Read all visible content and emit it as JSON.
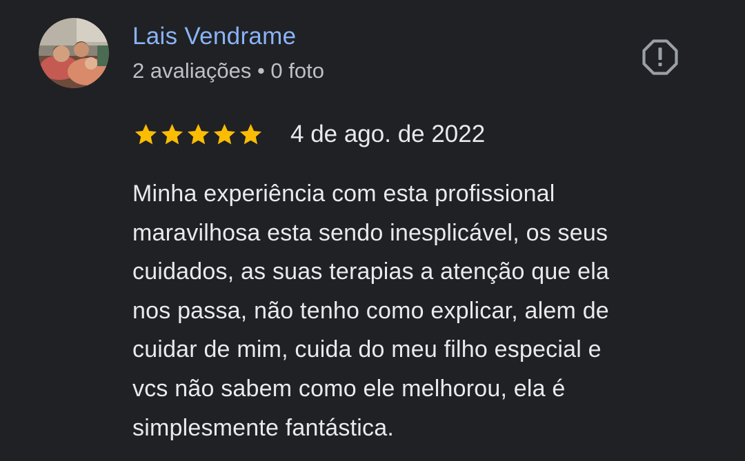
{
  "reviewer": {
    "name": "Lais Vendrame",
    "meta": "2 avaliações • 0 foto",
    "avatar_icon": "user-photo"
  },
  "rating": {
    "stars": 5,
    "max": 5,
    "color": "#fbbc04",
    "icon": "star-icon"
  },
  "review": {
    "date": "4 de ago. de 2022",
    "lines": [
      "Minha experiência com esta profissional",
      "maravilhosa esta sendo inesplicável, os seus",
      "cuidados, as suas terapias a atenção que ela",
      "nos passa, não tenho como explicar, alem de",
      "cuidar de mim, cuida do meu filho especial e",
      "vcs não sabem como ele melhorou, ela é",
      "simplesmente fantástica."
    ]
  },
  "actions": {
    "report_icon": "report-flag-icon"
  },
  "colors": {
    "background": "#202124",
    "name": "#8ab4f8",
    "meta": "#bdc1c6",
    "text": "#e8eaed",
    "star": "#fbbc04"
  }
}
